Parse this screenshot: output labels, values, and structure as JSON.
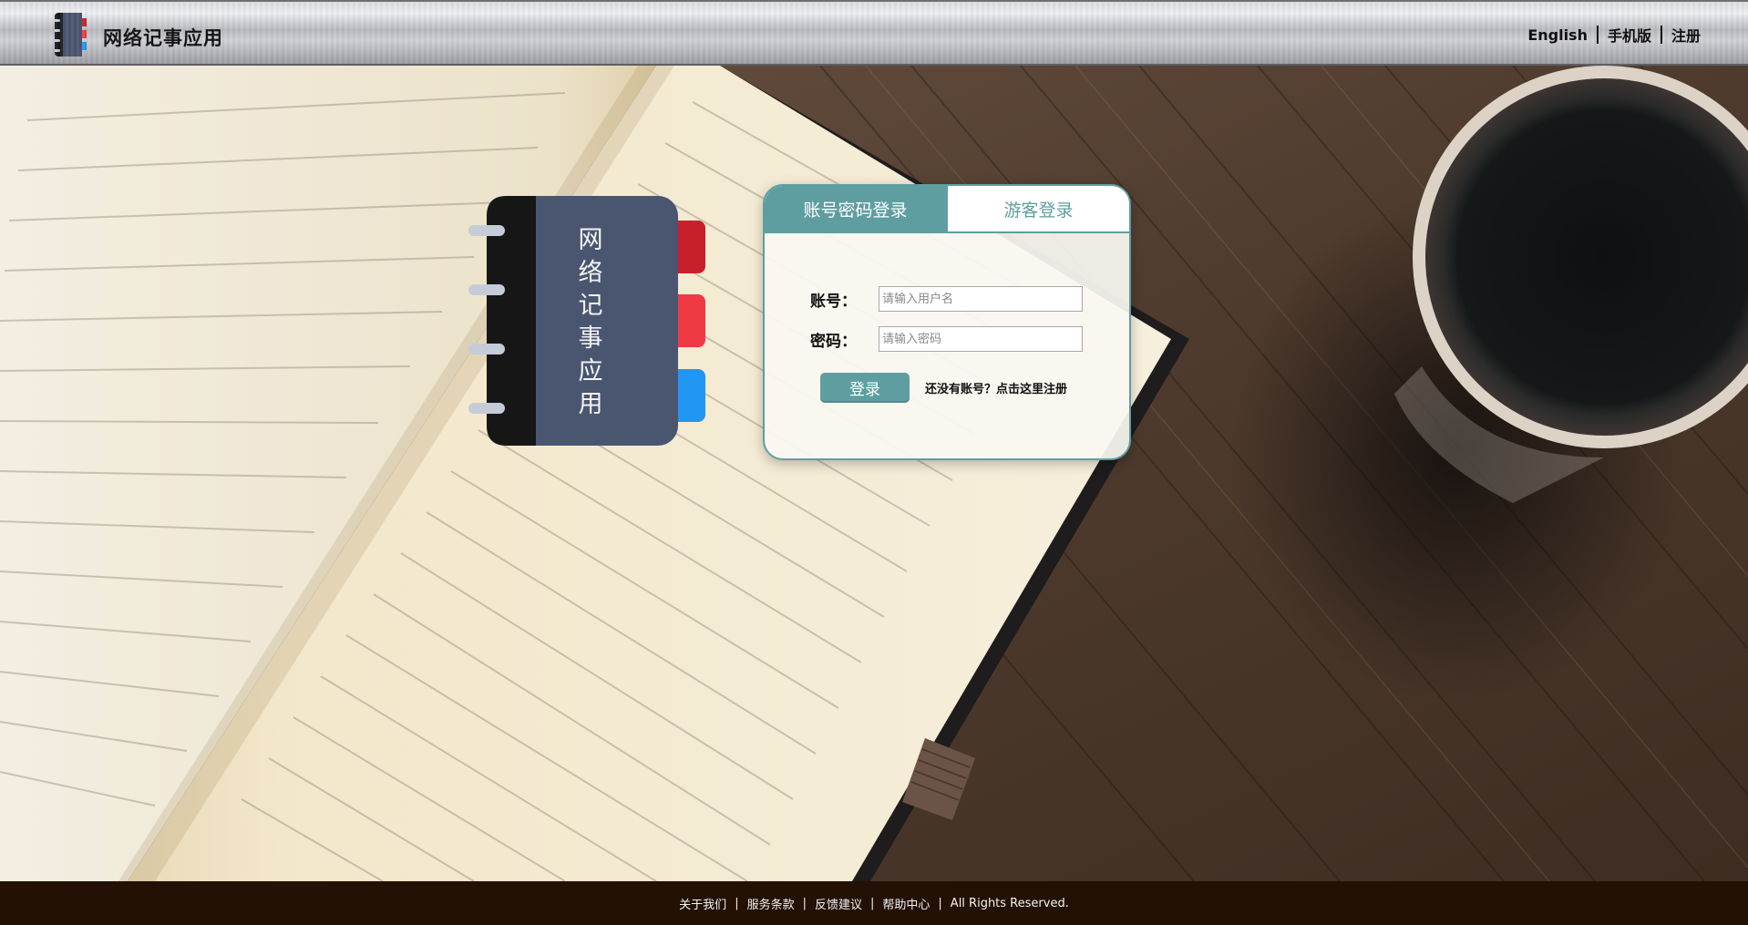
{
  "header": {
    "app_title": "网络记事应用",
    "nav": [
      "English",
      "手机版",
      "注册"
    ]
  },
  "notebook": {
    "cover_text": [
      "网",
      "络",
      "记",
      "事",
      "应",
      "用"
    ]
  },
  "login": {
    "tabs": [
      {
        "label": "账号密码登录",
        "active": true
      },
      {
        "label": "游客登录",
        "active": false
      }
    ],
    "username_label": "账号：",
    "username_value": "",
    "username_placeholder": "请输入用户名",
    "password_label": "密码：",
    "password_value": "",
    "password_placeholder": "请输入密码",
    "submit_label": "登录",
    "register_prompt": "还没有账号？点击这里注册"
  },
  "footer": {
    "links": [
      "关于我们",
      "服务条款",
      "反馈建议",
      "帮助中心"
    ],
    "copyright": "All Rights Reserved."
  },
  "colors": {
    "accent": "#5f9ea0",
    "footer_bg": "#231105",
    "notebook_cover": "#4a5670",
    "tab_red_dark": "#c8202a",
    "tab_red": "#ef3a44",
    "tab_blue": "#2196f3"
  }
}
